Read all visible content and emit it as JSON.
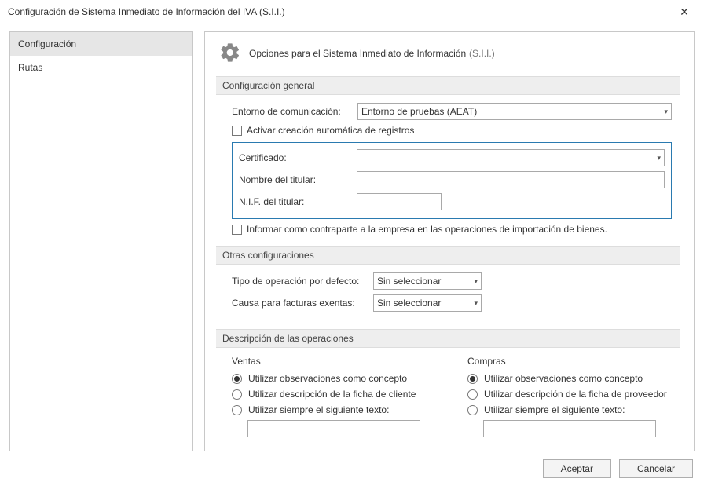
{
  "window": {
    "title": "Configuración de Sistema Inmediato de Información del IVA (S.I.I.)"
  },
  "sidebar": {
    "items": [
      {
        "label": "Configuración"
      },
      {
        "label": "Rutas"
      }
    ]
  },
  "header": {
    "title": "Opciones para el Sistema Inmediato de Información",
    "suffix": "(S.I.I.)"
  },
  "sections": {
    "general": {
      "title": "Configuración general",
      "env_label": "Entorno de comunicación:",
      "env_value": "Entorno de pruebas (AEAT)",
      "auto_create_label": "Activar creación automática de registros",
      "cert_label": "Certificado:",
      "cert_value": "",
      "titular_label": "Nombre del titular:",
      "titular_value": "",
      "nif_label": "N.I.F. del titular:",
      "nif_value": "",
      "counterpart_label": "Informar como contraparte a la empresa en las operaciones de importación de bienes."
    },
    "other": {
      "title": "Otras configuraciones",
      "op_type_label": "Tipo de operación por defecto:",
      "op_type_value": "Sin seleccionar",
      "exempt_label": "Causa para facturas exentas:",
      "exempt_value": "Sin seleccionar"
    },
    "desc": {
      "title": "Descripción de las operaciones",
      "sales_title": "Ventas",
      "purchases_title": "Compras",
      "opt_obs": "Utilizar observaciones como concepto",
      "opt_ficha_cliente": "Utilizar descripción de la ficha de cliente",
      "opt_ficha_proveedor": "Utilizar descripción de la ficha de proveedor",
      "opt_texto": "Utilizar siempre el siguiente texto:",
      "sales_text": "",
      "purchases_text": ""
    }
  },
  "footer": {
    "ok": "Aceptar",
    "cancel": "Cancelar"
  }
}
